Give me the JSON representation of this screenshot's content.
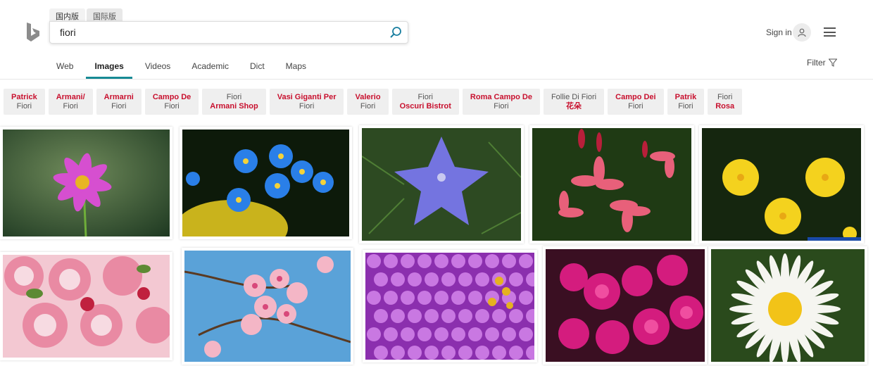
{
  "header": {
    "lang_tabs": [
      "国内版",
      "国际版"
    ],
    "search_value": "fiori",
    "signin_label": "Sign in"
  },
  "scope": {
    "items": [
      "Web",
      "Images",
      "Videos",
      "Academic",
      "Dict",
      "Maps"
    ],
    "active": "Images",
    "filter_label": "Filter"
  },
  "related": [
    {
      "line1": "Patrick",
      "line2": "Fiori",
      "bold_line": 1
    },
    {
      "line1": "Armani/",
      "line2": "Fiori",
      "bold_line": 1
    },
    {
      "line1": "Armarni",
      "line2": "Fiori",
      "bold_line": 1
    },
    {
      "line1": "Campo De",
      "line2": "Fiori",
      "bold_line": 1
    },
    {
      "line1": "Fiori",
      "line2": "Armani Shop",
      "bold_line": 2
    },
    {
      "line1": "Vasi Giganti Per",
      "line2": "Fiori",
      "bold_line": 1
    },
    {
      "line1": "Valerio",
      "line2": "Fiori",
      "bold_line": 1
    },
    {
      "line1": "Fiori",
      "line2": "Oscuri Bistrot",
      "bold_line": 2
    },
    {
      "line1": "Roma Campo De",
      "line2": "Fiori",
      "bold_line": 1
    },
    {
      "line1": "Follie Di Fiori",
      "line2": "花朵",
      "bold_line": 2
    },
    {
      "line1": "Campo Dei",
      "line2": "Fiori",
      "bold_line": 1
    },
    {
      "line1": "Patrik",
      "line2": "Fiori",
      "bold_line": 1
    },
    {
      "line1": "Fiori",
      "line2": "Rosa",
      "bold_line": 2
    }
  ],
  "images": [
    {
      "subject": "pink-cosmos-flower"
    },
    {
      "subject": "blue-forget-me-not-flowers"
    },
    {
      "subject": "purple-balloon-flower"
    },
    {
      "subject": "red-plumeria-flowers"
    },
    {
      "subject": "yellow-evening-primrose-flowers"
    },
    {
      "subject": "pink-roses-bouquet"
    },
    {
      "subject": "pink-cherry-blossoms"
    },
    {
      "subject": "purple-phlox-flowers"
    },
    {
      "subject": "magenta-bougainvillea"
    },
    {
      "subject": "white-daisy"
    }
  ],
  "colors": {
    "accent": "#178a95",
    "related_red": "#c8102e"
  }
}
